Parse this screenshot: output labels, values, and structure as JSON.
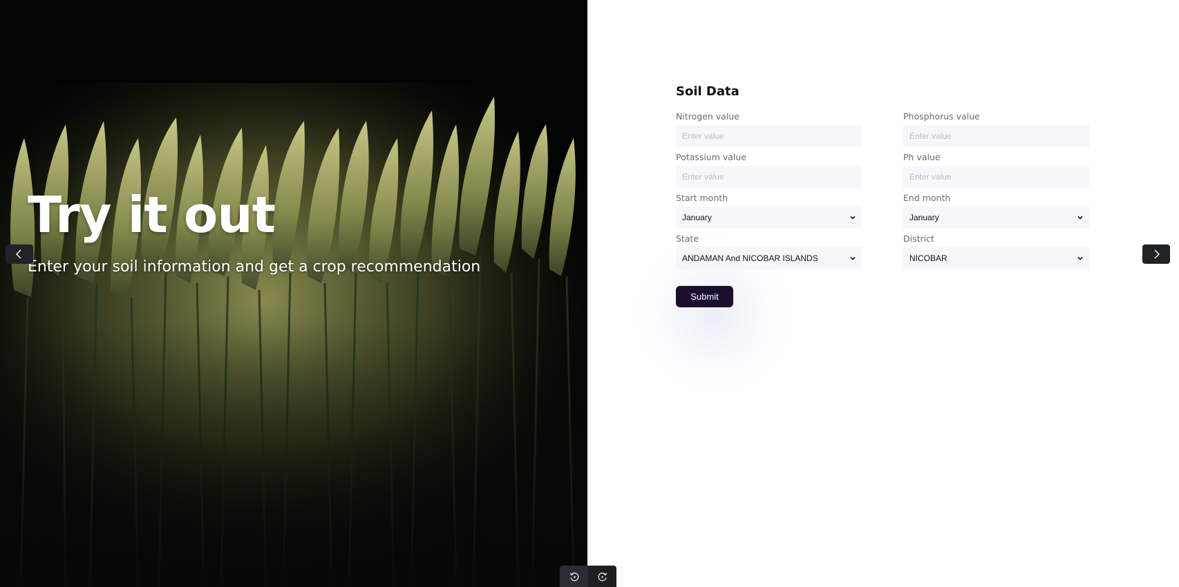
{
  "hero": {
    "title": "Try it out",
    "subtitle": "Enter your soil information and get a crop recommendation"
  },
  "form": {
    "title": "Soil Data",
    "fields": {
      "nitrogen": {
        "label": "Nitrogen value",
        "placeholder": "Enter value",
        "value": ""
      },
      "phosphorus": {
        "label": "Phosphorus value",
        "placeholder": "Enter value",
        "value": ""
      },
      "potassium": {
        "label": "Potassium value",
        "placeholder": "Enter value",
        "value": ""
      },
      "ph": {
        "label": "Ph value",
        "placeholder": "Enter value",
        "value": ""
      },
      "start_month": {
        "label": "Start month",
        "selected": "January"
      },
      "end_month": {
        "label": "End month",
        "selected": "January"
      },
      "state": {
        "label": "State",
        "selected": "ANDAMAN And NICOBAR ISLANDS"
      },
      "district": {
        "label": "District",
        "selected": "NICOBAR"
      }
    },
    "submit_label": "Submit"
  },
  "icons": {
    "prev": "chevron-left-icon",
    "next": "chevron-right-icon",
    "undo": "undo-icon",
    "redo": "redo-icon"
  },
  "colors": {
    "submit_bg": "#1b0d2e",
    "input_bg": "#f6f7fb",
    "nav_bg": "#1f2326"
  }
}
